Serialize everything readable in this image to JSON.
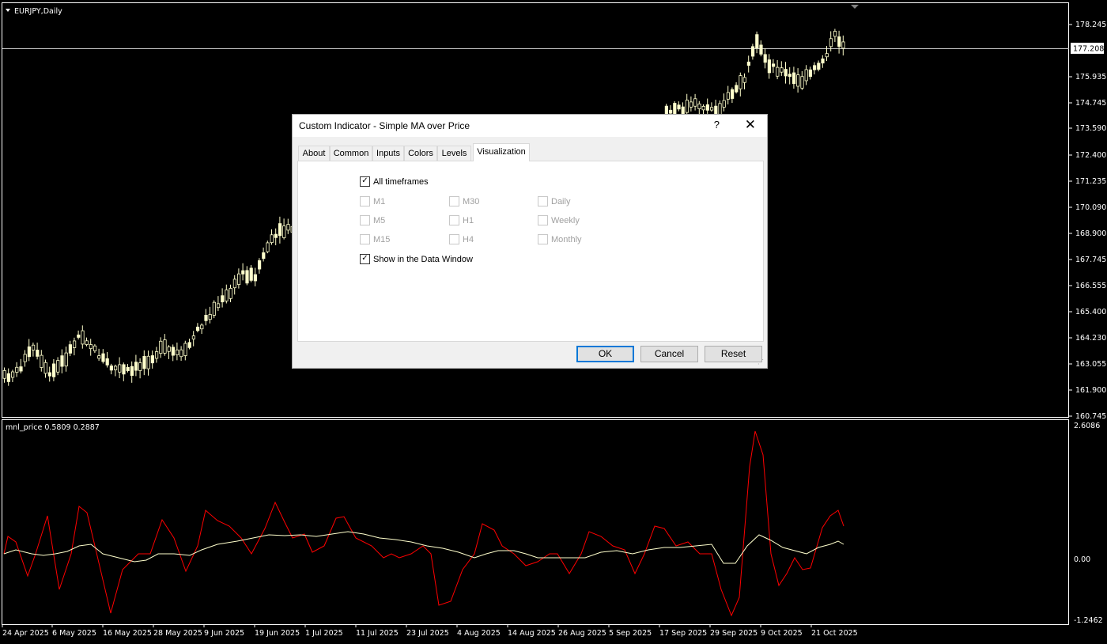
{
  "chart": {
    "symbol": "EURJPY,Daily",
    "price_axis": [
      "178.245",
      "177.208",
      "175.935",
      "174.745",
      "173.590",
      "172.400",
      "171.235",
      "170.090",
      "168.900",
      "167.745",
      "166.555",
      "165.400",
      "164.230",
      "163.055",
      "161.900",
      "160.745"
    ],
    "current_price": "177.208",
    "colors": {
      "candle": "#ffffcc",
      "indicator_red": "#ff0000",
      "indicator_ma": "#ffffcc",
      "grid": "#ffffff"
    }
  },
  "indicator": {
    "label": "mnl_price 0.5809 0.2887",
    "axis": [
      "2.6086",
      "0.00",
      "-1.2462"
    ]
  },
  "time_axis": [
    "24 Apr 2025",
    "6 May 2025",
    "16 May 2025",
    "28 May 2025",
    "9 Jun 2025",
    "19 Jun 2025",
    "1 Jul 2025",
    "11 Jul 2025",
    "23 Jul 2025",
    "4 Aug 2025",
    "14 Aug 2025",
    "26 Aug 2025",
    "5 Sep 2025",
    "17 Sep 2025",
    "29 Sep 2025",
    "9 Oct 2025",
    "21 Oct 2025"
  ],
  "dialog": {
    "title": "Custom Indicator - Simple MA over Price",
    "help": "?",
    "close": "✕",
    "tabs": [
      "About",
      "Common",
      "Inputs",
      "Colors",
      "Levels",
      "Visualization"
    ],
    "active_tab": "Visualization",
    "all_timeframes": "All timeframes",
    "timeframes": [
      "M1",
      "M30",
      "Daily",
      "M5",
      "H1",
      "Weekly",
      "M15",
      "H4",
      "Monthly"
    ],
    "show_data_window": "Show in the Data Window",
    "buttons": {
      "ok": "OK",
      "cancel": "Cancel",
      "reset": "Reset"
    }
  }
}
